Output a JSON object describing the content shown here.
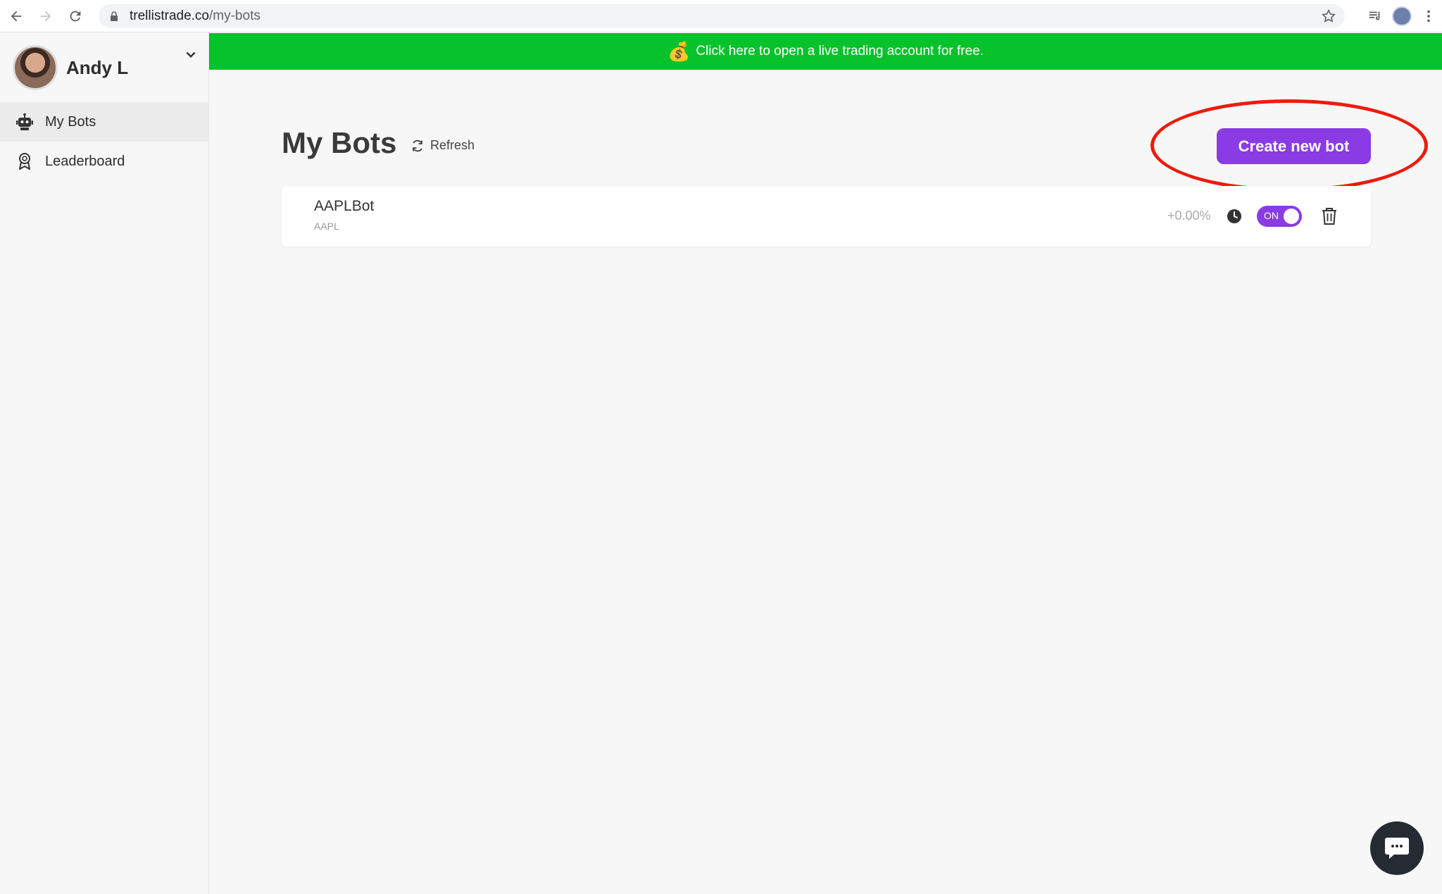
{
  "browser": {
    "url_domain": "trellistrade.co",
    "url_path": "/my-bots"
  },
  "sidebar": {
    "user_name": "Andy L",
    "items": [
      {
        "label": "My Bots",
        "icon": "robot-icon"
      },
      {
        "label": "Leaderboard",
        "icon": "award-ribbon-icon"
      }
    ]
  },
  "banner": {
    "emoji": "💰",
    "text": "Click here to open a live trading account for free."
  },
  "main": {
    "title": "My Bots",
    "refresh_label": "Refresh",
    "create_label": "Create new bot"
  },
  "bots": [
    {
      "name": "AAPLBot",
      "ticker": "AAPL",
      "performance": "+0.00%",
      "toggle_label": "ON"
    }
  ],
  "colors": {
    "banner_green": "#07c22b",
    "accent_purple": "#8a3be3",
    "annotation_red": "#ef1a0d"
  }
}
